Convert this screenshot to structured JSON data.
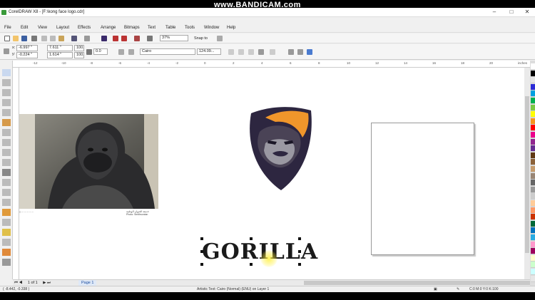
{
  "window": {
    "title": "CorelDRAW X8 - [F:\\kong face logo.cdr]",
    "minimize": "‒",
    "maximize": "□",
    "close": "✕"
  },
  "watermark": "www.BANDICAM.com",
  "menu": [
    "File",
    "Edit",
    "View",
    "Layout",
    "Effects",
    "Arrange",
    "Bitmaps",
    "Text",
    "Table",
    "Tools",
    "Window",
    "Help"
  ],
  "toolbar": {
    "zoom": "37%",
    "snap_to": "Snap to"
  },
  "property_bar": {
    "x": "-6.997 \"",
    "y": "-0.224 \"",
    "width": "7.611 \"",
    "height": "1.614 \"",
    "scale_w": "100.0",
    "scale_h": "100.0",
    "rotation": "0.0",
    "font": "Cairo",
    "font_size": "124.09..."
  },
  "ruler": {
    "units": "inches",
    "labels": [
      "-12",
      "-10",
      "-8",
      "-6",
      "-4",
      "-2",
      "0",
      "2",
      "4",
      "6",
      "8",
      "10",
      "12",
      "14",
      "16",
      "18",
      "20"
    ]
  },
  "canvas": {
    "photo_caption_line1": "حديقة الحيوان الوطنية",
    "photo_caption_line2": "Photo: Smithsonian",
    "photo_note": "© ─ ─ ─ ─ ─",
    "text_object": "GORILLA"
  },
  "page_nav": {
    "count": "1 of 1",
    "tab": "Page 1"
  },
  "status": {
    "coords": "( -8.442, -0.338 )",
    "object_info": "Artistic Text: Cairo (Normal) (ENU) on Layer 1",
    "color_info": "C:0 M:0 Y:0 K:100"
  },
  "colors": {
    "logo_dark": "#2d2640",
    "logo_orange": "#f0962b",
    "selection": "#111111",
    "accent": "#3a9a3a"
  },
  "palette_colors": [
    "#ffffff",
    "#000000",
    "#e5e5e5",
    "#2b2bd6",
    "#00a0e0",
    "#00b050",
    "#7ac943",
    "#ffff00",
    "#f7941d",
    "#ff0000",
    "#ec008c",
    "#92278f",
    "#662d91",
    "#603913",
    "#8c6239",
    "#c69c6d",
    "#998675",
    "#666666",
    "#999999",
    "#cccccc",
    "#ffcc99",
    "#ff9966",
    "#cc3300",
    "#006837",
    "#0071bc",
    "#29abe2",
    "#ff99cc",
    "#9e005d",
    "#ffffcc",
    "#ccffcc",
    "#ccffff",
    "#e6e6e6"
  ]
}
